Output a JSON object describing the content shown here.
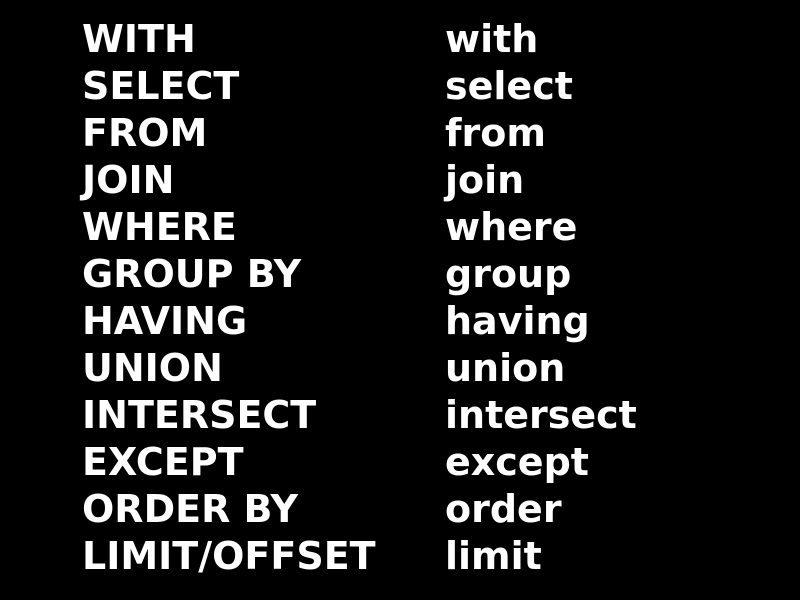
{
  "keywords": [
    {
      "upper": "WITH",
      "lower": "with"
    },
    {
      "upper": "SELECT",
      "lower": "select"
    },
    {
      "upper": "FROM",
      "lower": "from"
    },
    {
      "upper": "JOIN",
      "lower": "join"
    },
    {
      "upper": "WHERE",
      "lower": "where"
    },
    {
      "upper": "GROUP BY",
      "lower": "group"
    },
    {
      "upper": "HAVING",
      "lower": "having"
    },
    {
      "upper": "UNION",
      "lower": "union"
    },
    {
      "upper": "INTERSECT",
      "lower": "intersect"
    },
    {
      "upper": "EXCEPT",
      "lower": "except"
    },
    {
      "upper": "ORDER BY",
      "lower": "order"
    },
    {
      "upper": "LIMIT/OFFSET",
      "lower": "limit"
    }
  ],
  "colors": {
    "background": "#000000",
    "text": "#ffffff"
  }
}
